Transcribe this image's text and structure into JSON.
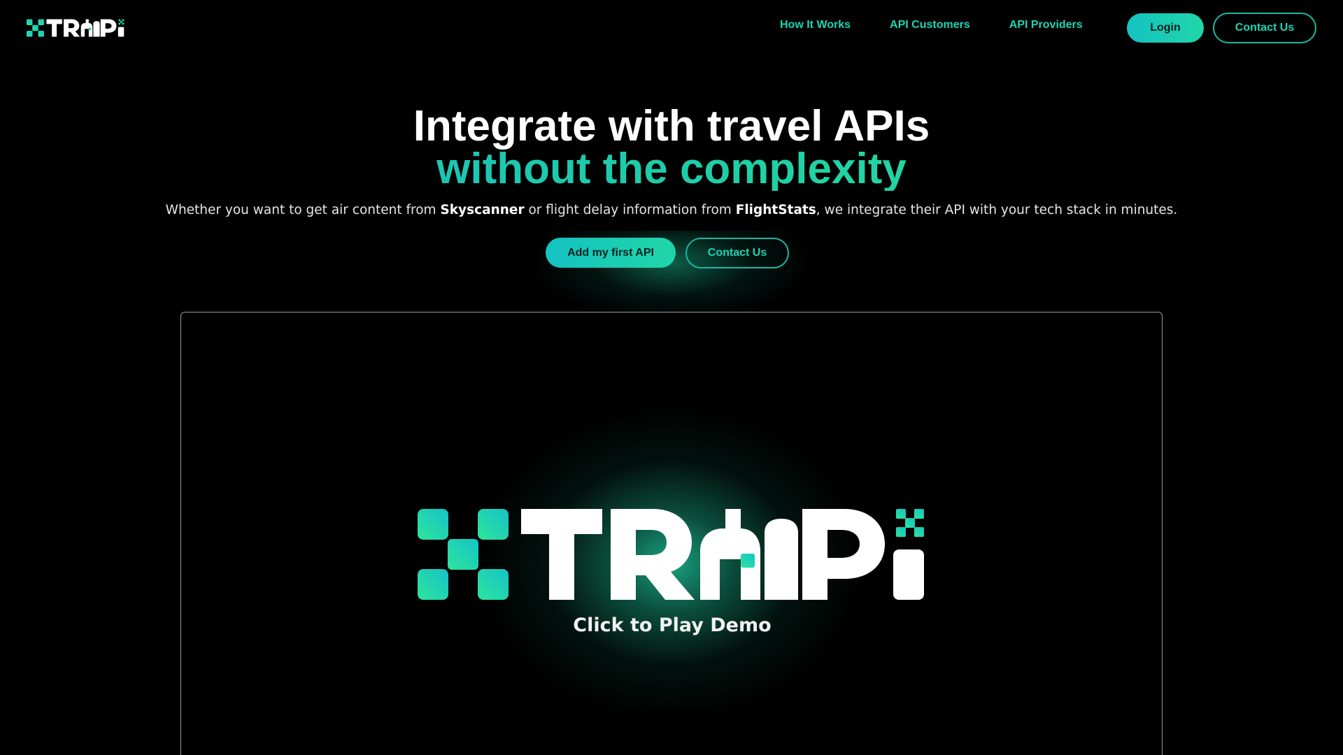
{
  "brand": {
    "logo_text": "TRAPI"
  },
  "nav": {
    "items": [
      {
        "label": "How It Works"
      },
      {
        "label": "API Customers"
      },
      {
        "label": "API Providers"
      }
    ],
    "login_label": "Login",
    "contact_label": "Contact Us"
  },
  "hero": {
    "title_line1": "Integrate with travel APIs",
    "title_line2": "without the complexity",
    "sub_part1": "Whether you want to get air content from ",
    "sub_bold1": "Skyscanner",
    "sub_part2": " or flight delay information from ",
    "sub_bold2": "FlightStats",
    "sub_part3": ", we integrate their API with your tech stack in minutes.",
    "cta_primary": "Add my first API",
    "cta_secondary": "Contact Us"
  },
  "demo": {
    "play_label": "Click to Play Demo"
  },
  "colors": {
    "accent": "#1fd3b5",
    "gradient_start": "#14c2c2",
    "gradient_end": "#20d6a8",
    "background": "#000000"
  },
  "icons": {
    "logo_mark": "x-cross-logo-icon"
  }
}
